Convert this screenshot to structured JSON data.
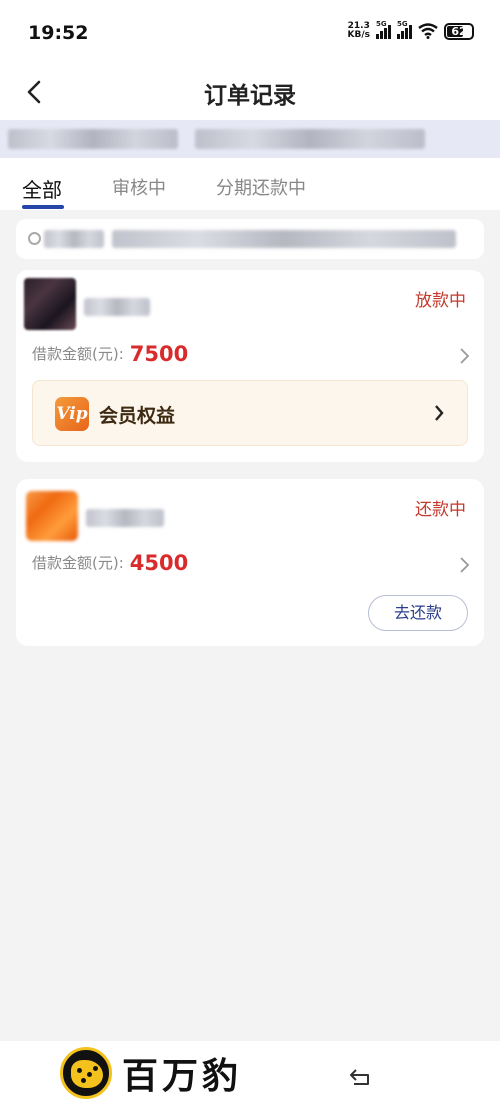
{
  "status_bar": {
    "time": "19:52",
    "net_speed_value": "21.3",
    "net_speed_unit": "KB/s",
    "signal1_label": "5G",
    "signal2_label": "5G",
    "battery": "62"
  },
  "header": {
    "title": "订单记录"
  },
  "tabs": [
    {
      "label": "全部",
      "active": true
    },
    {
      "label": "审核中",
      "active": false
    },
    {
      "label": "分期还款中",
      "active": false
    }
  ],
  "orders": [
    {
      "status": "放款中",
      "amount_label": "借款金额(元):",
      "amount": "7500",
      "vip_badge": "Vip",
      "vip_label": "会员权益"
    },
    {
      "status": "还款中",
      "amount_label": "借款金额(元):",
      "amount": "4500",
      "action_label": "去还款"
    }
  ],
  "brand": {
    "name": "百万豹"
  },
  "colors": {
    "accent": "#2446a8",
    "status_red": "#c43a2e",
    "amount_red": "#d92b2b",
    "vip_orange": "#e7651a"
  }
}
